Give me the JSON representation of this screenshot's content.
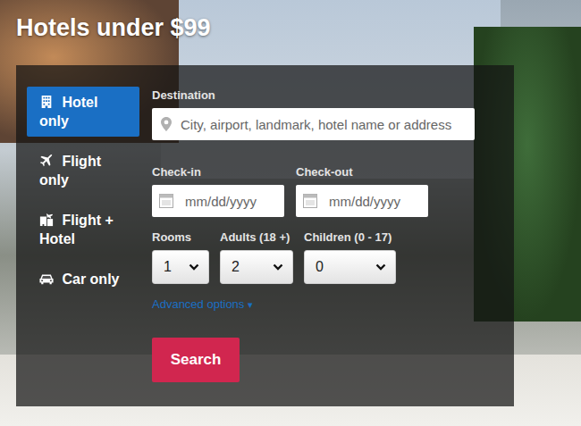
{
  "page": {
    "title": "Hotels under $99"
  },
  "tabs": [
    {
      "label": "Hotel only",
      "selected": true
    },
    {
      "label": "Flight only",
      "selected": false
    },
    {
      "label": "Flight + Hotel",
      "selected": false
    },
    {
      "label": "Car only",
      "selected": false
    }
  ],
  "form": {
    "destination": {
      "label": "Destination",
      "placeholder": "City, airport, landmark, hotel name or address"
    },
    "dates": [
      {
        "label": "Check-in",
        "placeholder": "mm/dd/yyyy"
      },
      {
        "label": "Check-out",
        "placeholder": "mm/dd/yyyy"
      }
    ],
    "selects": [
      {
        "label": "Rooms",
        "value": "1"
      },
      {
        "label": "Adults (18 +)",
        "value": "2"
      },
      {
        "label": "Children (0 - 17)",
        "value": "0"
      }
    ],
    "advanced": {
      "label": "Advanced options",
      "arrow": "▾"
    },
    "search_button": "Search"
  }
}
